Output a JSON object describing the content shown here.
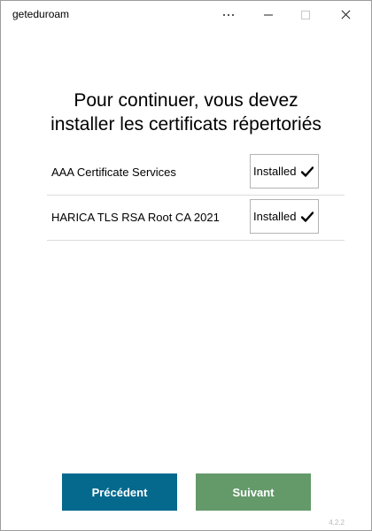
{
  "window": {
    "title": "geteduroam"
  },
  "heading": {
    "line1": "Pour continuer, vous devez",
    "line2": "installer les certificats répertoriés"
  },
  "certificates": [
    {
      "name": "AAA Certificate Services",
      "status": "Installed"
    },
    {
      "name": "HARICA TLS RSA Root CA 2021",
      "status": "Installed"
    }
  ],
  "buttons": {
    "previous_label": "Précédent",
    "next_label": "Suivant"
  },
  "footer": {
    "version": "4.2.2"
  },
  "colors": {
    "previous_button": "#04698d",
    "next_button": "#649a6a"
  },
  "icons": {
    "more": "more-options-icon",
    "minimize": "minimize-icon",
    "maximize": "maximize-icon",
    "close": "close-icon",
    "status": "checkmark-icon"
  }
}
